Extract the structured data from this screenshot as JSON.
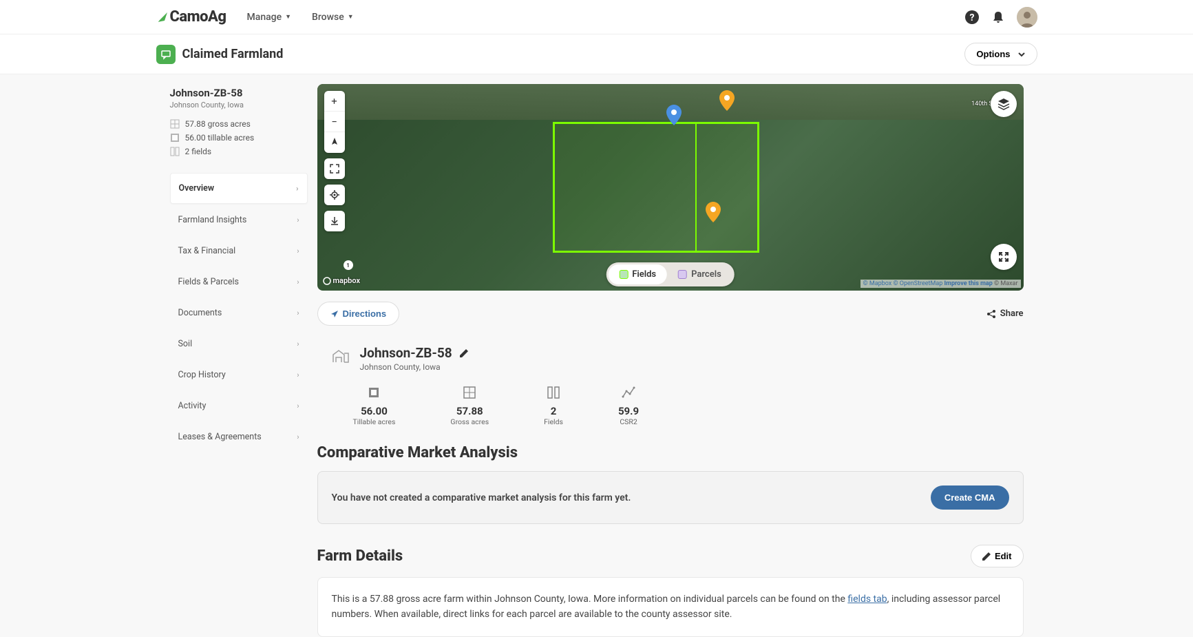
{
  "brand": {
    "name_prefix": "C",
    "name_rest": "amoAg"
  },
  "nav": {
    "manage": "Manage",
    "browse": "Browse"
  },
  "header": {
    "page_title": "Claimed Farmland",
    "options": "Options"
  },
  "property": {
    "name": "Johnson-ZB-58",
    "location": "Johnson County, Iowa",
    "gross_acres_line": "57.88 gross acres",
    "tillable_acres_line": "56.00 tillable acres",
    "fields_line": "2 fields"
  },
  "sidebar_tabs": {
    "overview": "Overview",
    "insights": "Farmland Insights",
    "tax": "Tax & Financial",
    "fields": "Fields & Parcels",
    "documents": "Documents",
    "soil": "Soil",
    "crop": "Crop History",
    "activity": "Activity",
    "leases": "Leases & Agreements"
  },
  "map": {
    "toggle_fields": "Fields",
    "toggle_parcels": "Parcels",
    "mapbox": "mapbox",
    "attr_mapbox": "© Mapbox",
    "attr_osm": "© OpenStreetMap",
    "attr_improve": "Improve this map",
    "attr_maxar": "© Maxar",
    "road": "140th St NE",
    "badge": "1"
  },
  "actions": {
    "directions": "Directions",
    "share": "Share"
  },
  "farm": {
    "title": "Johnson-ZB-58",
    "subtitle": "Johnson County, Iowa",
    "stats": {
      "tillable_val": "56.00",
      "tillable_label": "Tillable acres",
      "gross_val": "57.88",
      "gross_label": "Gross acres",
      "fields_val": "2",
      "fields_label": "Fields",
      "csr2_val": "59.9",
      "csr2_label": "CSR2"
    }
  },
  "cma": {
    "title": "Comparative Market Analysis",
    "empty_text": "You have not created a comparative market analysis for this farm yet.",
    "button": "Create CMA"
  },
  "farm_details": {
    "title": "Farm Details",
    "edit": "Edit",
    "text_1": "This is a 57.88 gross acre farm within Johnson County, Iowa. More information on individual parcels can be found on the ",
    "link": "fields tab",
    "text_2": ", including assessor parcel numbers. When available, direct links for each parcel are available to the county assessor site."
  }
}
